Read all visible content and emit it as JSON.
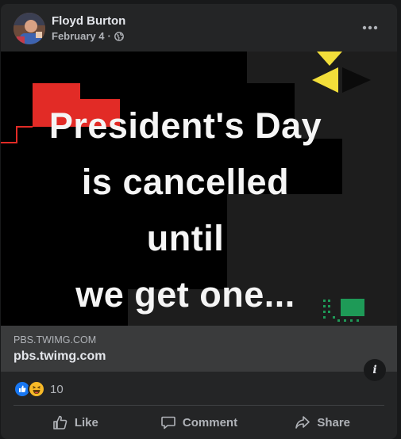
{
  "post": {
    "author": "Floyd Burton",
    "date": "February 4",
    "separator": "·",
    "privacy_icon": "globe-icon",
    "more_icon": "more-horizontal-icon"
  },
  "image": {
    "lines": [
      "President's Day",
      "is cancelled",
      "until",
      "we get one..."
    ],
    "colors": {
      "background": "#000000",
      "accent_red": "#e22b26",
      "accent_yellow": "#f2de3a",
      "accent_green": "#1e9a57"
    }
  },
  "link": {
    "domain_caps": "PBS.TWIMG.COM",
    "domain": "pbs.twimg.com",
    "info_label": "i"
  },
  "reactions": {
    "icons": [
      "like-reaction-icon",
      "haha-reaction-icon"
    ],
    "count": "10"
  },
  "actions": {
    "like": "Like",
    "comment": "Comment",
    "share": "Share"
  }
}
